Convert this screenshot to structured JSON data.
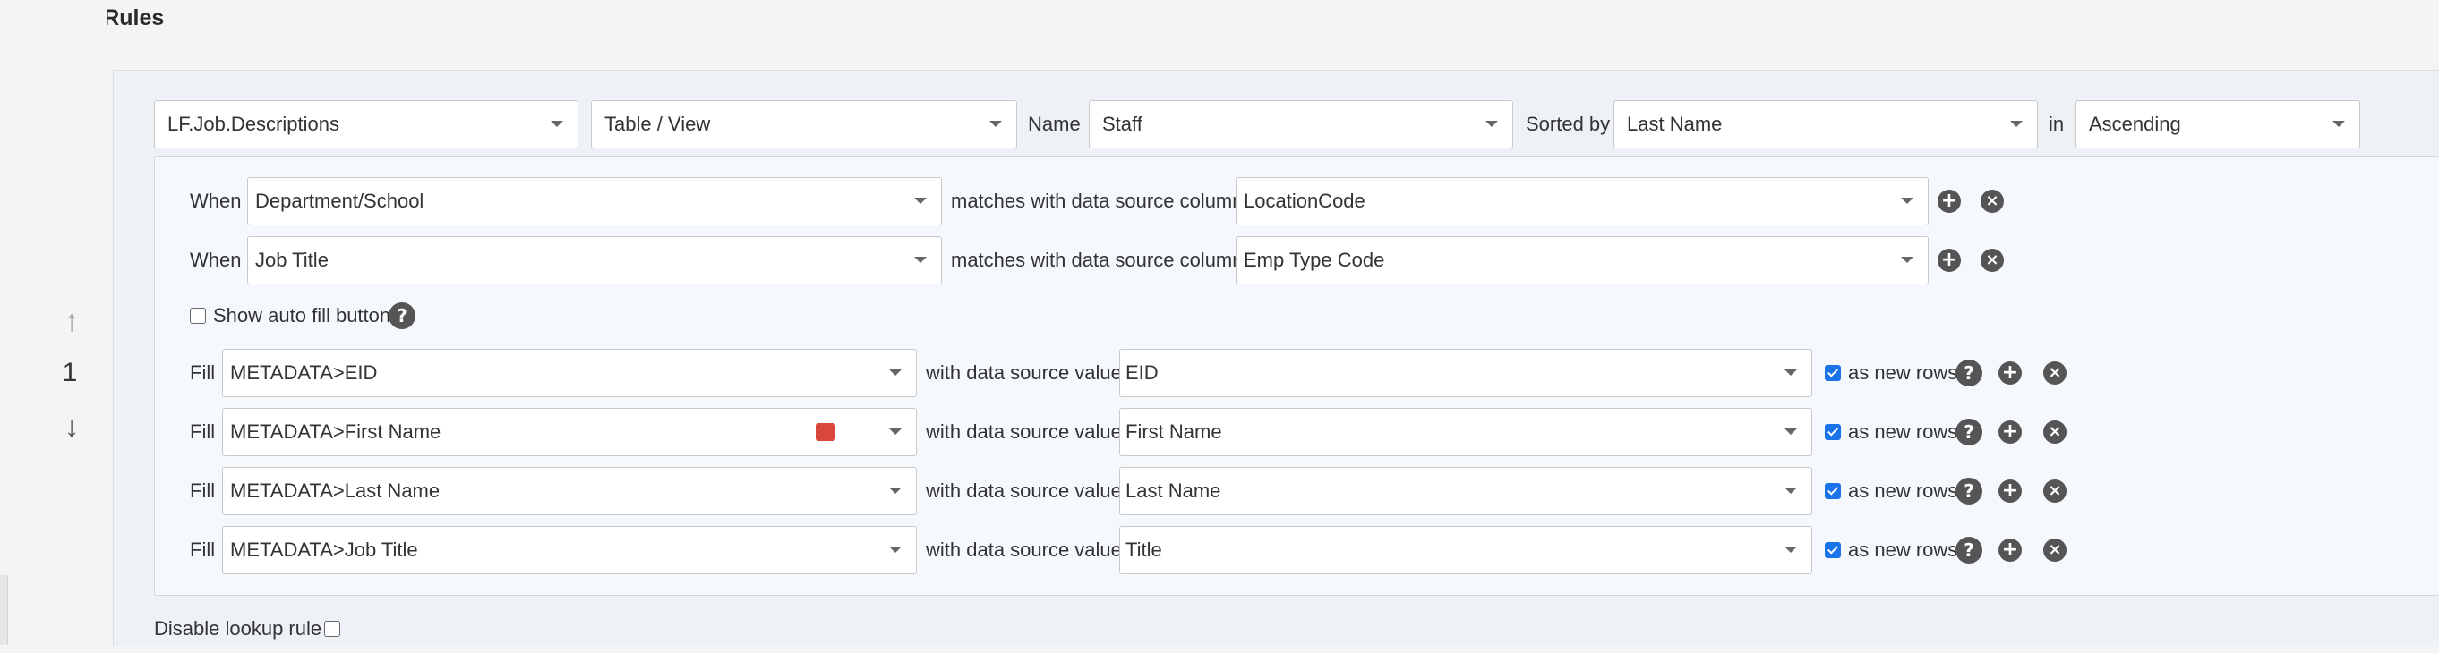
{
  "page": {
    "title": "Lookup Rules"
  },
  "rule": {
    "index": "1",
    "move_up_icon": "arrow-up-icon",
    "move_down_icon": "arrow-down-icon",
    "drag_icon": "drag-handle-icon",
    "source": {
      "connection": "LF.Job.Descriptions",
      "object_type": "Table / View",
      "name_label": "Name",
      "name": "Staff",
      "sorted_by_label": "Sorted by",
      "sorted_by": "Last Name",
      "in_label": "in",
      "order": "Ascending"
    },
    "conditions": [
      {
        "when_label": "When",
        "field": "Department/School",
        "matches_label": "matches with data source column",
        "column": "LocationCode"
      },
      {
        "when_label": "When",
        "field": "Job Title",
        "matches_label": "matches with data source column",
        "column": "Emp Type Code"
      }
    ],
    "show_auto_fill": {
      "label": "Show auto fill button",
      "checked": false
    },
    "fills": [
      {
        "fill_label": "Fill",
        "field": "METADATA>EID",
        "value_label": "with data source value",
        "value": "EID",
        "as_new_rows_label": "as new rows",
        "as_new_rows": true,
        "has_token_icon": false
      },
      {
        "fill_label": "Fill",
        "field": "METADATA>First Name",
        "value_label": "with data source value",
        "value": "First Name",
        "as_new_rows_label": "as new rows",
        "as_new_rows": true,
        "has_token_icon": true
      },
      {
        "fill_label": "Fill",
        "field": "METADATA>Last Name",
        "value_label": "with data source value",
        "value": "Last Name",
        "as_new_rows_label": "as new rows",
        "as_new_rows": true,
        "has_token_icon": false
      },
      {
        "fill_label": "Fill",
        "field": "METADATA>Job Title",
        "value_label": "with data source value",
        "value": "Title",
        "as_new_rows_label": "as new rows",
        "as_new_rows": true,
        "has_token_icon": false
      }
    ],
    "disable": {
      "label": "Disable lookup rule",
      "checked": false
    }
  },
  "colors": {
    "checkbox_checked": "#1a73e8",
    "token_icon": "#d9463b",
    "icon_button": "#555555"
  }
}
